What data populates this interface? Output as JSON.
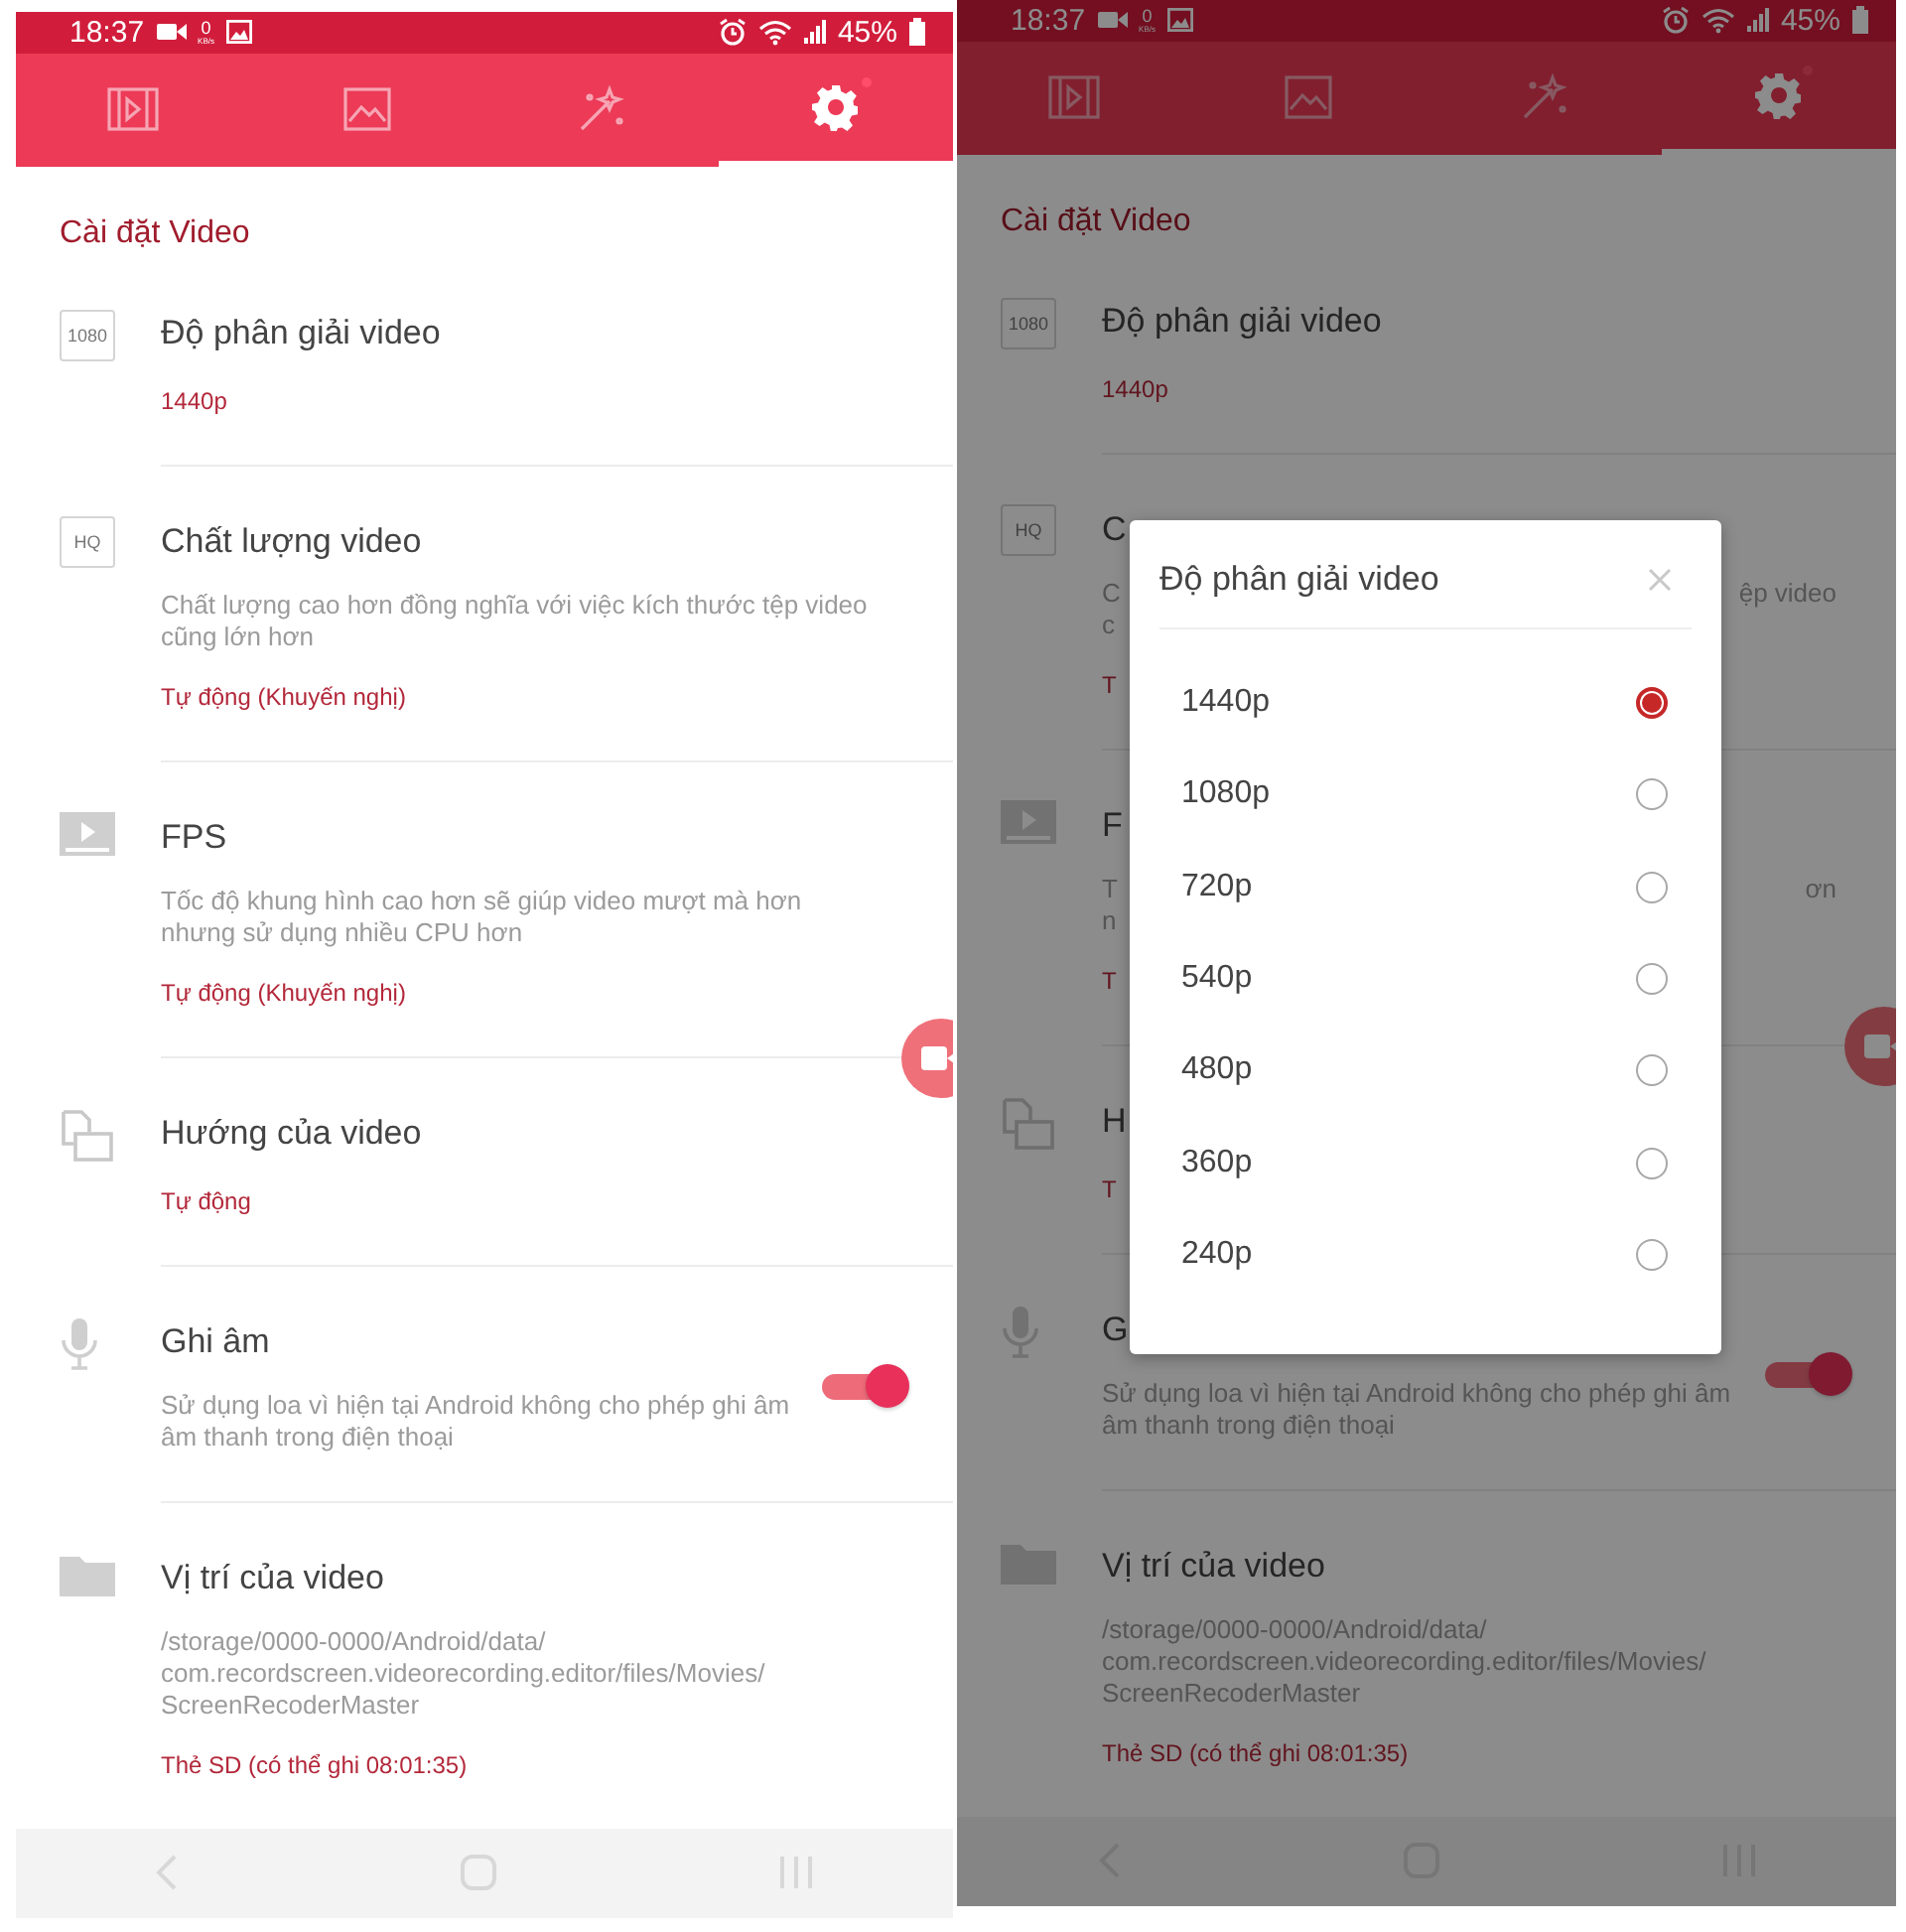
{
  "panels": [
    {
      "status_bar": {
        "time": "18:37",
        "net_value": "0",
        "net_unit": "KB/s",
        "battery": "45%"
      },
      "tabs": [
        {
          "selected": false
        },
        {
          "selected": false
        },
        {
          "selected": false
        },
        {
          "selected": true
        }
      ],
      "section_title": "Cài đặt Video",
      "settings": [
        {
          "icon_label": "1080",
          "title": "Độ phân giải video",
          "value": "1440p"
        },
        {
          "icon_label": "HQ",
          "title": "Chất lượng video",
          "description": "Chất lượng cao hơn đồng nghĩa với việc kích thước tệp video\ncũng lớn hơn",
          "value": "Tự động (Khuyến nghị)"
        },
        {
          "title": "FPS",
          "description": "Tốc độ khung hình cao hơn sẽ giúp video mượt mà hơn\nnhưng sử dụng nhiều CPU hơn",
          "value": "Tự động (Khuyến nghị)"
        },
        {
          "title": "Hướng của video",
          "value": "Tự động"
        },
        {
          "title": "Ghi âm",
          "description": "Sử dụng loa vì hiện tại Android không cho phép ghi âm\nâm thanh trong điện thoại",
          "toggle": {
            "on": true
          }
        },
        {
          "title": "Vị trí của video",
          "description": "/storage/0000-0000/Android/data/\ncom.recordscreen.videorecording.editor/files/Movies/\nScreenRecoderMaster",
          "value": "Thẻ SD (có thể ghi 08:01:35)"
        }
      ]
    },
    {
      "status_bar": {
        "time": "18:37",
        "net_value": "0",
        "net_unit": "KB/s",
        "battery": "45%"
      },
      "tabs": [
        {
          "selected": false
        },
        {
          "selected": false
        },
        {
          "selected": false
        },
        {
          "selected": true
        }
      ],
      "section_title": "Cài đặt Video",
      "settings": [
        {
          "icon_label": "1080",
          "title": "Độ phân giải video",
          "value": "1440p"
        },
        {
          "icon_label": "HQ",
          "title": "C",
          "description": "C\nc",
          "description_right": "ệp video",
          "value": "T"
        },
        {
          "title": "F",
          "description": "T\nn",
          "description_right": "ơn",
          "value": "T"
        },
        {
          "title": "H",
          "value": "T"
        },
        {
          "title": "G",
          "description": "Sử dụng loa vì hiện tại Android không cho phép ghi âm\nâm thanh trong điện thoại",
          "toggle": {
            "on": true
          }
        },
        {
          "title": "Vị trí của video",
          "description": "/storage/0000-0000/Android/data/\ncom.recordscreen.videorecording.editor/files/Movies/\nScreenRecoderMaster",
          "value": "Thẻ SD (có thể ghi 08:01:35)"
        }
      ],
      "dialog": {
        "title": "Độ phân giải video",
        "options": [
          {
            "label": "1440p",
            "selected": true
          },
          {
            "label": "1080p",
            "selected": false
          },
          {
            "label": "720p",
            "selected": false
          },
          {
            "label": "540p",
            "selected": false
          },
          {
            "label": "480p",
            "selected": false
          },
          {
            "label": "360p",
            "selected": false
          },
          {
            "label": "240p",
            "selected": false
          }
        ]
      }
    }
  ]
}
